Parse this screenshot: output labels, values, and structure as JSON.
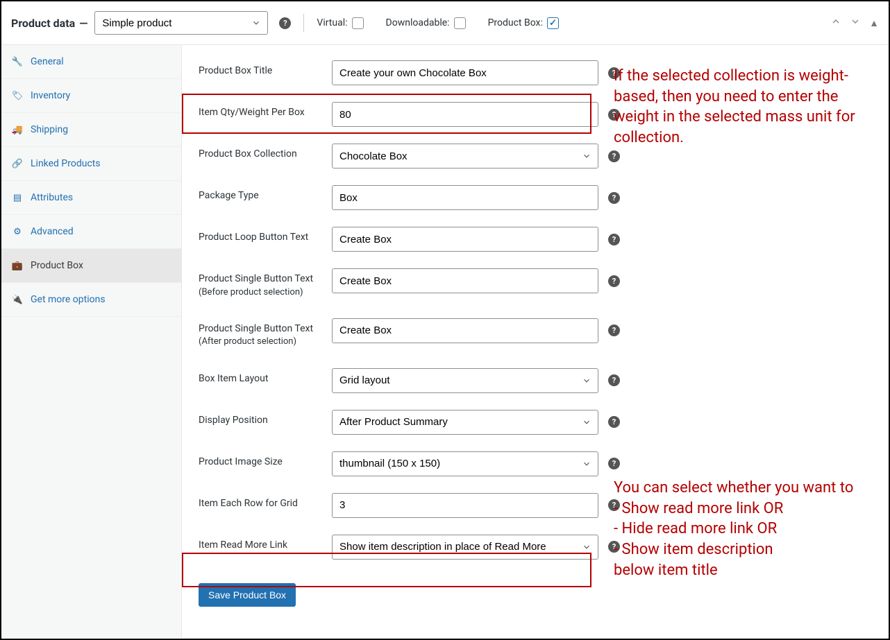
{
  "header": {
    "title": "Product data",
    "dash": "—",
    "product_type": "Simple product",
    "virtual_label": "Virtual:",
    "downloadable_label": "Downloadable:",
    "product_box_label": "Product Box:",
    "virtual_checked": false,
    "downloadable_checked": false,
    "product_box_checked": true
  },
  "sidebar": {
    "items": [
      {
        "label": "General",
        "icon": "wrench"
      },
      {
        "label": "Inventory",
        "icon": "tag"
      },
      {
        "label": "Shipping",
        "icon": "truck"
      },
      {
        "label": "Linked Products",
        "icon": "link"
      },
      {
        "label": "Attributes",
        "icon": "panel"
      },
      {
        "label": "Advanced",
        "icon": "gear"
      },
      {
        "label": "Product Box",
        "icon": "briefcase"
      },
      {
        "label": "Get more options",
        "icon": "plug"
      }
    ]
  },
  "form": {
    "title_label": "Product Box Title",
    "title_value": "Create your own Chocolate Box",
    "qty_label": "Item Qty/Weight Per Box",
    "qty_value": "80",
    "collection_label": "Product Box Collection",
    "collection_value": "Chocolate Box",
    "package_label": "Package Type",
    "package_value": "Box",
    "loop_btn_label": "Product Loop Button Text",
    "loop_btn_value": "Create Box",
    "single_before_label": "Product Single Button Text",
    "single_before_sub": "(Before product selection)",
    "single_before_value": "Create Box",
    "single_after_label": "Product Single Button Text",
    "single_after_sub": "(After product selection)",
    "single_after_value": "Create Box",
    "layout_label": "Box Item Layout",
    "layout_value": "Grid layout",
    "position_label": "Display Position",
    "position_value": "After Product Summary",
    "image_size_label": "Product Image Size",
    "image_size_value": "thumbnail (150 x 150)",
    "each_row_label": "Item Each Row for Grid",
    "each_row_value": "3",
    "readmore_label": "Item Read More Link",
    "readmore_value": "Show item description in place of Read More",
    "save_label": "Save Product Box"
  },
  "annotations": {
    "a": "If the selected collection is weight-based, then you need to enter the weight in the selected mass unit for collection.",
    "b": "You can select whether you want to\n- Show read more link OR\n- Hide read more link OR\n- Show item description\n   below item title"
  }
}
